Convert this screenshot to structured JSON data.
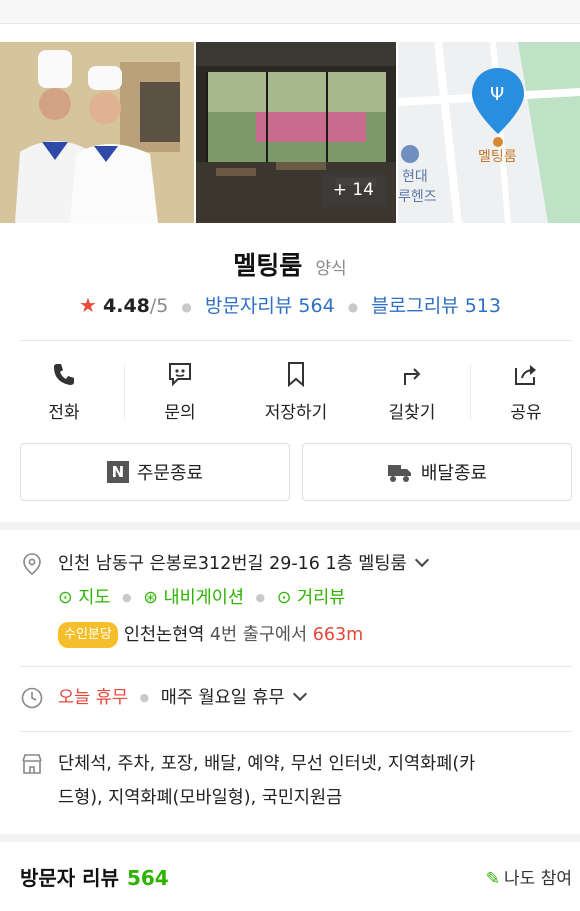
{
  "gallery": {
    "more_count": "+ 14"
  },
  "map": {
    "poi_label": "멜팅룸",
    "nearby_label_1": "현대",
    "nearby_label_2": "루헨즈"
  },
  "place": {
    "name": "멜팅룸",
    "category": "양식"
  },
  "rating": {
    "score": "4.48",
    "max": "/5",
    "visitor_reviews": "방문자리뷰 564",
    "blog_reviews": "블로그리뷰 513"
  },
  "actions": [
    {
      "label": "전화",
      "icon": "phone-icon"
    },
    {
      "label": "문의",
      "icon": "chat-icon"
    },
    {
      "label": "저장하기",
      "icon": "bookmark-icon"
    },
    {
      "label": "길찾기",
      "icon": "directions-icon"
    },
    {
      "label": "공유",
      "icon": "share-icon"
    }
  ],
  "buttons": {
    "order": "주문종료",
    "order_badge": "N",
    "delivery": "배달종료"
  },
  "address": {
    "text": "인천 남동구 은봉로312번길 29-16 1층 멜팅룸",
    "links": {
      "map": "지도",
      "navigation": "내비게이션",
      "street": "거리뷰"
    },
    "line_badge": "수인분당",
    "station": "인천논현역",
    "exit": "4번 출구에서",
    "distance": "663m"
  },
  "hours": {
    "status": "오늘 휴무",
    "detail": "매주 월요일 휴무"
  },
  "amenities": {
    "line1": "단체석, 주차, 포장, 배달, 예약, 무선 인터넷, 지역화폐(카",
    "line2": "드형), 지역화폐(모바일형), 국민지원금"
  },
  "review_section": {
    "title": "방문자 리뷰",
    "count": "564",
    "join_label": "나도 참여"
  },
  "colors": {
    "accent_green": "#2db400",
    "link_blue": "#2f6fc4",
    "star_red": "#e84c3d",
    "badge_yellow": "#f4bf2a"
  }
}
